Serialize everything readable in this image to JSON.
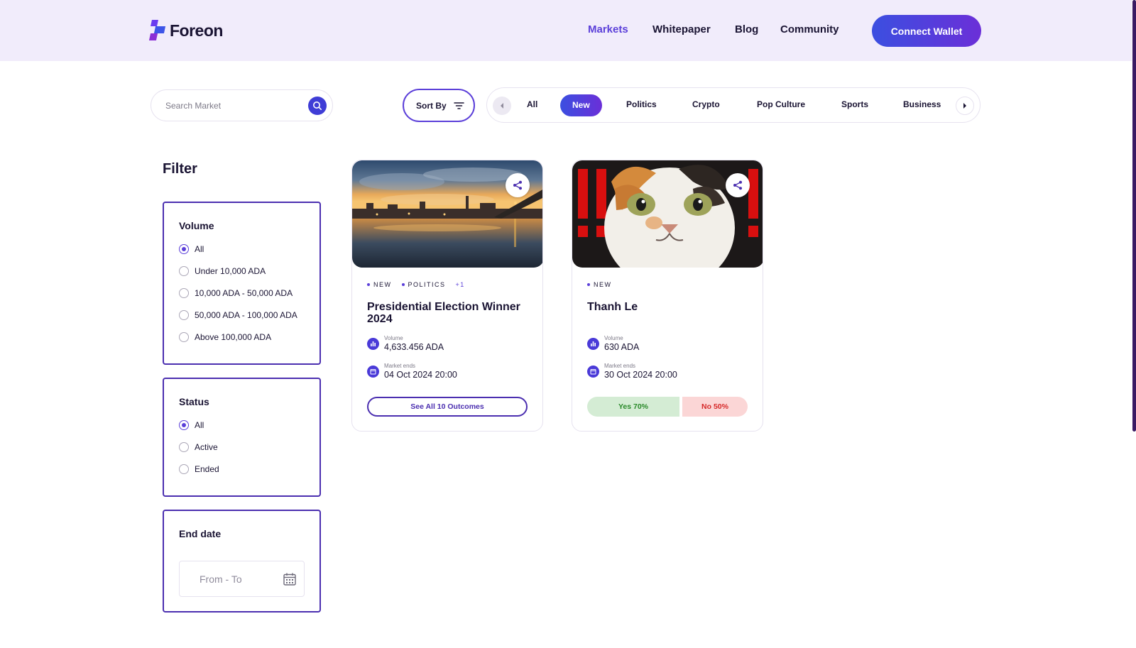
{
  "header": {
    "logo_text": "Foreon",
    "nav": [
      {
        "label": "Markets",
        "active": true
      },
      {
        "label": "Whitepaper",
        "active": false
      },
      {
        "label": "Blog",
        "active": false
      },
      {
        "label": "Community",
        "active": false
      }
    ],
    "connect_label": "Connect Wallet"
  },
  "toolbar": {
    "search_placeholder": "Search Market",
    "sort_label": "Sort By",
    "categories": [
      "All",
      "New",
      "Politics",
      "Crypto",
      "Pop Culture",
      "Sports",
      "Business"
    ],
    "active_category": "New"
  },
  "filter": {
    "title": "Filter",
    "volume": {
      "heading": "Volume",
      "options": [
        "All",
        "Under 10,000 ADA",
        "10,000 ADA - 50,000 ADA",
        "50,000 ADA - 100,000 ADA",
        "Above 100,000 ADA"
      ],
      "selected": "All"
    },
    "status": {
      "heading": "Status",
      "options": [
        "All",
        "Active",
        "Ended"
      ],
      "selected": "All"
    },
    "end_date": {
      "heading": "End date",
      "placeholder": "From - To"
    }
  },
  "cards": [
    {
      "tags": [
        "NEW",
        "POLITICS"
      ],
      "extra_tags": "+1",
      "title": "Presidential Election Winner 2024",
      "volume_label": "Volume",
      "volume": "4,633.456 ADA",
      "ends_label": "Market ends",
      "ends": "04 Oct 2024 20:00",
      "outcomes_label": "See All 10 Outcomes"
    },
    {
      "tags": [
        "NEW"
      ],
      "title": "Thanh Le",
      "volume_label": "Volume",
      "volume": "630 ADA",
      "ends_label": "Market ends",
      "ends": "30 Oct 2024 20:00",
      "yes_label": "Yes 70%",
      "no_label": "No 50%"
    }
  ],
  "colors": {
    "accent": "#5b3fd9",
    "header_bg": "#f1ecfb",
    "yes_bg": "#d4ecd4",
    "no_bg": "#fbd6d6"
  }
}
